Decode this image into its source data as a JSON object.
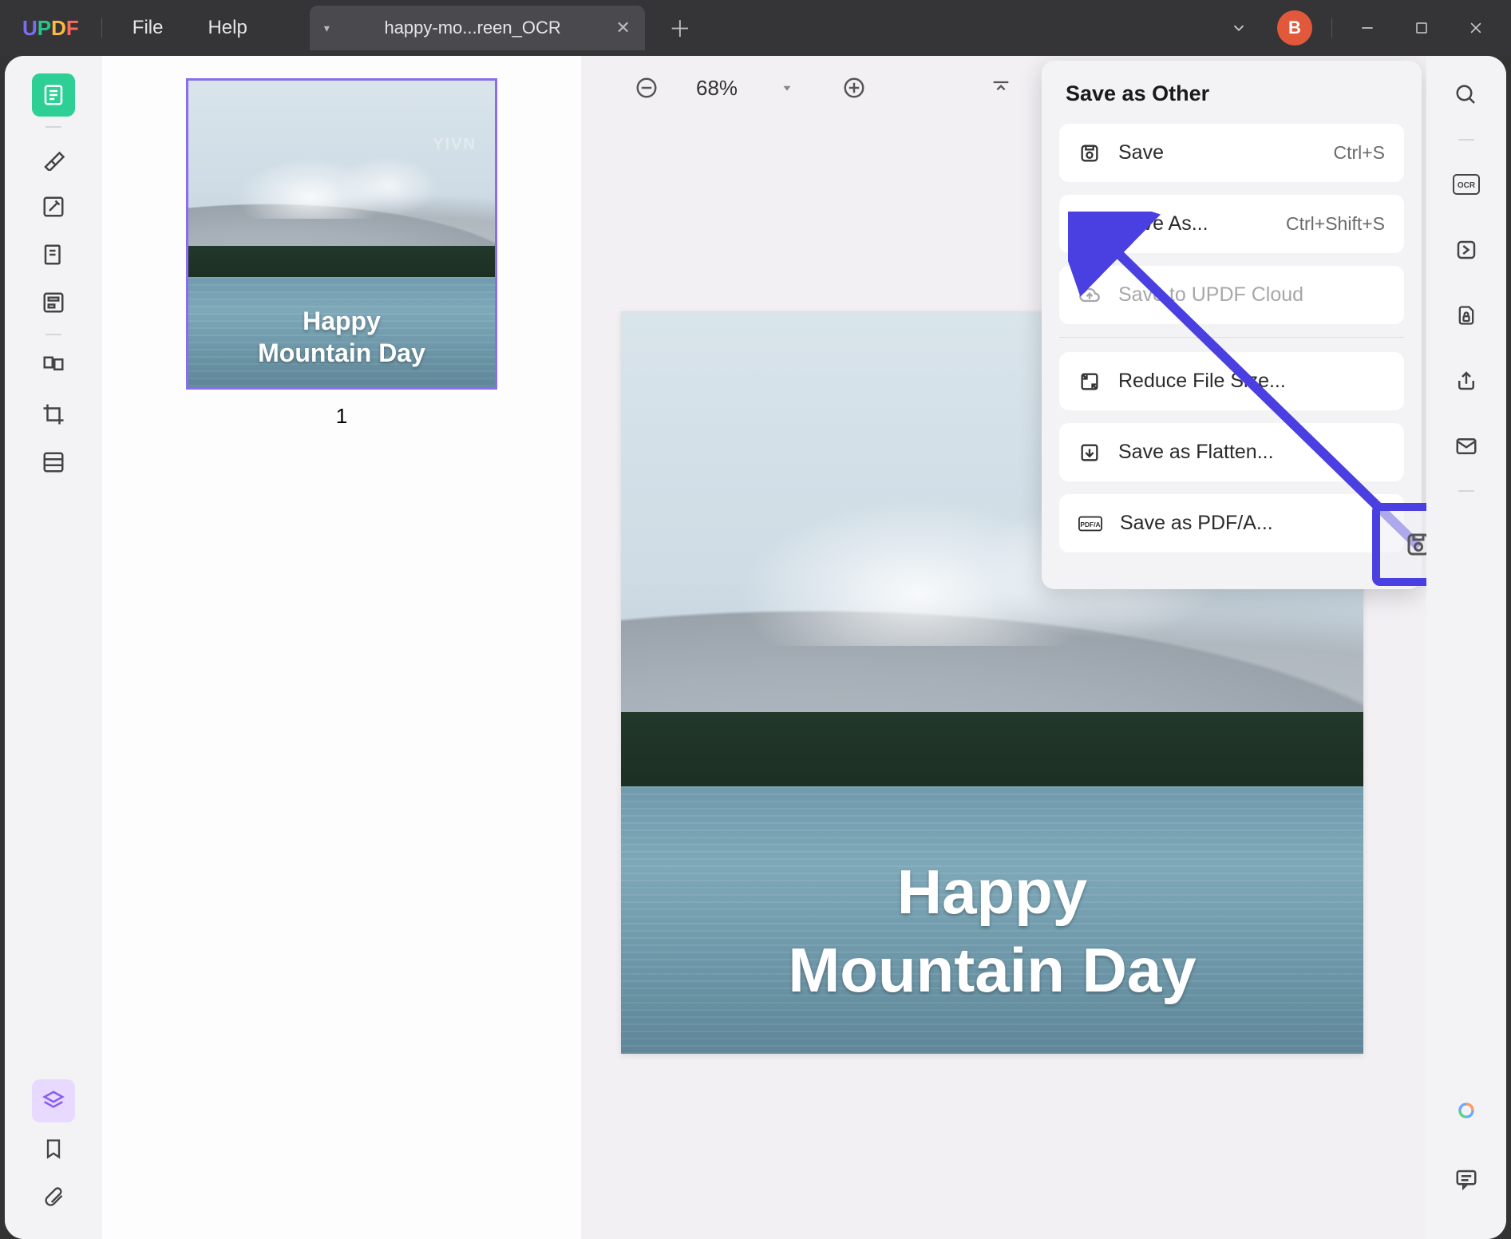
{
  "app": {
    "logo_text": "UPDF"
  },
  "menu": {
    "file": "File",
    "help": "Help"
  },
  "tab": {
    "name": "happy-mo...reen_OCR"
  },
  "user": {
    "initial": "B"
  },
  "zoom": {
    "value": "68%"
  },
  "thumbs": {
    "page1_number": "1"
  },
  "doc": {
    "caption_line1": "Happy",
    "caption_line2": "Mountain Day",
    "watermark": "YIVN"
  },
  "panel": {
    "title": "Save as Other",
    "save": {
      "label": "Save",
      "shortcut": "Ctrl+S"
    },
    "save_as": {
      "label": "Save As...",
      "shortcut": "Ctrl+Shift+S"
    },
    "save_cloud": {
      "label": "Save to UPDF Cloud"
    },
    "reduce": {
      "label": "Reduce File Size..."
    },
    "flatten": {
      "label": "Save as Flatten..."
    },
    "pdfa": {
      "label": "Save as PDF/A..."
    }
  },
  "icons": {
    "search": "search-icon",
    "ocr": "ocr-icon",
    "convert": "convert-icon",
    "protect": "protect-icon",
    "share": "share-icon",
    "email": "email-icon",
    "save": "save-icon",
    "ai": "ai-icon",
    "comment": "comment-icon"
  }
}
